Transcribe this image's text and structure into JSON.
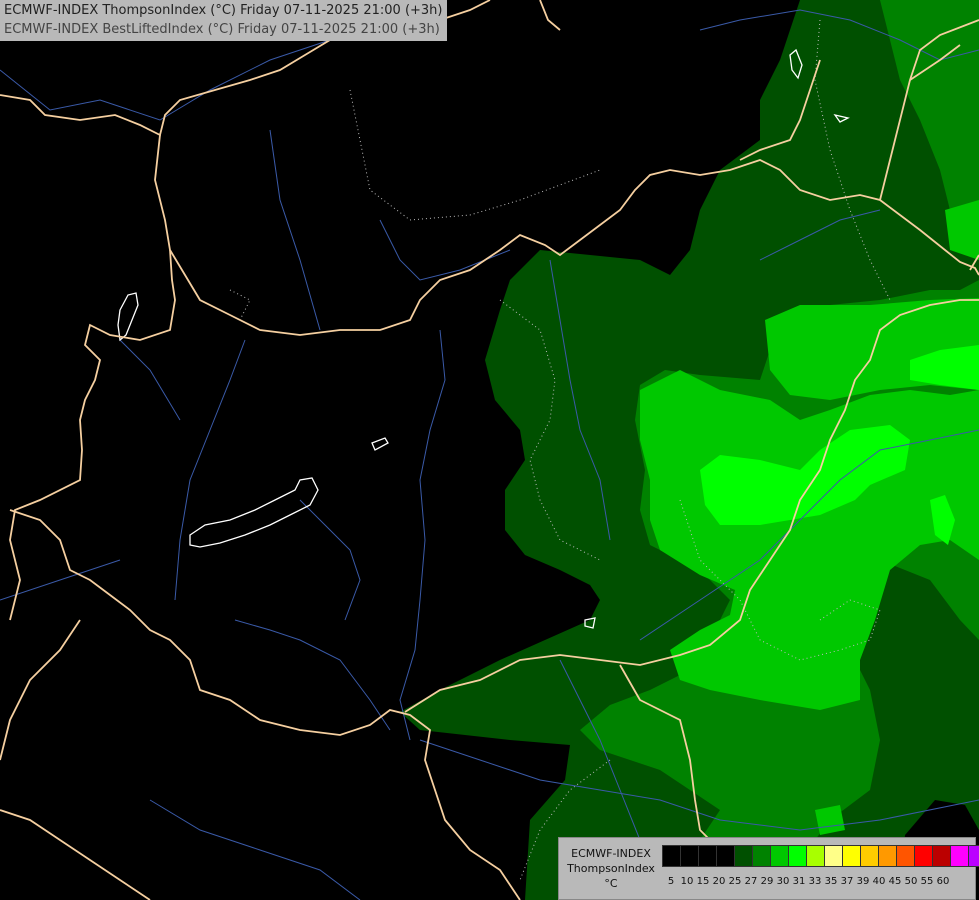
{
  "title": {
    "line1": "ECMWF-INDEX ThompsonIndex (°C) Friday 07-11-2025 21:00 (+3h)",
    "line2": "ECMWF-INDEX BestLiftedIndex (°C) Friday 07-11-2025 21:00 (+3h)"
  },
  "legend": {
    "label_model": "ECMWF-INDEX",
    "label_index": "ThompsonIndex",
    "label_unit": "°C",
    "ticks": [
      "5",
      "10",
      "15",
      "20",
      "25",
      "27",
      "29",
      "30",
      "31",
      "33",
      "35",
      "37",
      "39",
      "40",
      "45",
      "50",
      "55",
      "60"
    ],
    "colors": [
      "#000000",
      "#000000",
      "#000000",
      "#000000",
      "#005000",
      "#008200",
      "#00c800",
      "#00ff00",
      "#a8ff00",
      "#ffff88",
      "#ffff00",
      "#ffcc00",
      "#ff9900",
      "#ff5500",
      "#ff0000",
      "#bb0000",
      "#ff00ff",
      "#bb00ff",
      "#7a00ff",
      "#0000ff"
    ]
  },
  "colors": {
    "background": "#000000",
    "border": "#f5cfa0",
    "river": "#3a5aa8",
    "dark_green": "#005000",
    "mid_green": "#008200",
    "light_green": "#00c800",
    "bright_green": "#00ff00",
    "contour": "#bbbbbb"
  }
}
